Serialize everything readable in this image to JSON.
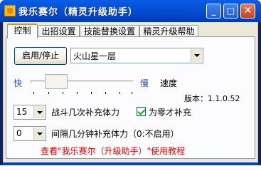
{
  "window": {
    "title": "我乐赛尔（精灵升级助手）",
    "minimize_glyph": "_",
    "maximize_glyph": "□",
    "close_glyph": "✕"
  },
  "tabs": [
    {
      "label": "控制",
      "active": true
    },
    {
      "label": "出招设置",
      "active": false
    },
    {
      "label": "技能替换设置",
      "active": false
    },
    {
      "label": "精灵升级帮助",
      "active": false
    }
  ],
  "controls": {
    "start_stop_label": "启用/停止",
    "scene_select_value": "火山星一层",
    "slider_fast_label": "快",
    "slider_slow_label": "慢",
    "speed_label": "速度",
    "speed_value_fraction": 0.18,
    "version_text": "版本：1.1.0.52",
    "battle_count_value": "15",
    "battle_count_label": "战斗几次补充体力",
    "zero_only_checked": true,
    "zero_only_label": "为零才补充",
    "interval_value": "0",
    "interval_label": "间隔几分钟补充体力（0:不启用）",
    "help_link": "查看\"我乐赛尔（升级助手）\"使用教程"
  },
  "colors": {
    "titlebar": "#0451d6",
    "slider_label": "#1f4fd1",
    "link": "#e00000",
    "active_tab_accent": "#e68b2c"
  }
}
